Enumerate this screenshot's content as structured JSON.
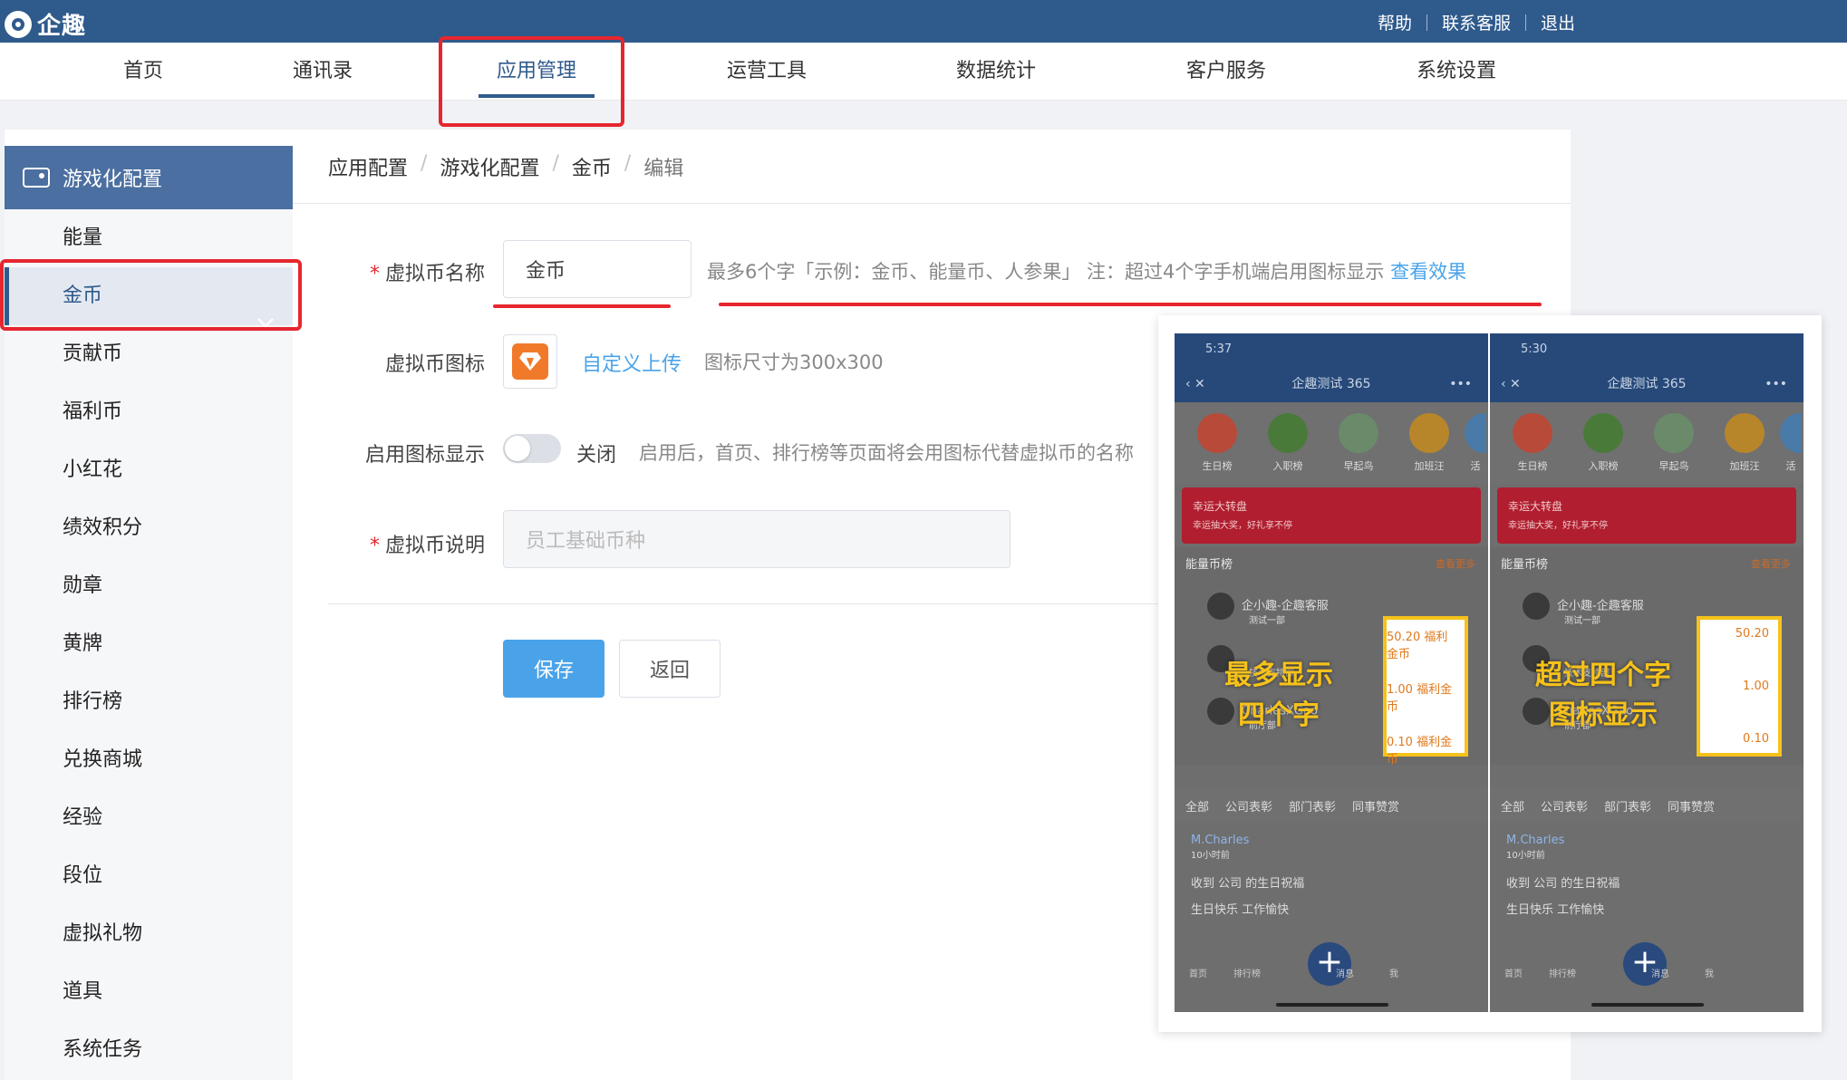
{
  "app": {
    "title": "企趣"
  },
  "toplinks": [
    "帮助",
    "联系客服",
    "退出"
  ],
  "nav": [
    "首页",
    "通讯录",
    "应用管理",
    "运营工具",
    "数据统计",
    "客户服务",
    "系统设置"
  ],
  "sidebar": {
    "header": "游戏化配置",
    "items": [
      "能量",
      "金币",
      "贡献币",
      "福利币",
      "小红花",
      "绩效积分",
      "勋章",
      "黄牌",
      "排行榜",
      "兑换商城",
      "经验",
      "段位",
      "虚拟礼物",
      "道具",
      "系统任务"
    ]
  },
  "breadcrumb": [
    "应用配置",
    "游戏化配置",
    "金币",
    "编辑"
  ],
  "form": {
    "name_label": "虚拟币名称",
    "name_value": "金币",
    "name_hint": "最多6个字「示例：金币、能量币、人参果」  注：超过4个字手机端启用图标显示",
    "name_link": "查看效果",
    "icon_label": "虚拟币图标",
    "icon_upload": "自定义上传",
    "icon_hint": "图标尺寸为300x300",
    "toggle_label": "启用图标显示",
    "toggle_state": "关闭",
    "toggle_hint": "启用后，首页、排行榜等页面将会用图标代替虚拟币的名称",
    "desc_label": "虚拟币说明",
    "desc_placeholder": "员工基础币种",
    "save": "保存",
    "back": "返回"
  },
  "preview": {
    "phones": [
      {
        "time": "5:37",
        "title": "企趣测试 365",
        "icons": [
          "生日榜",
          "入职榜",
          "早起鸟",
          "加班汪",
          "活"
        ],
        "banner_title": "幸运大转盘",
        "banner_sub": "幸运抽大奖，好礼享不停",
        "rank_title": "能量币榜",
        "rank_more": "查看更多",
        "rows": [
          {
            "name": "企小趣-企趣客服",
            "dept": "测试一部"
          },
          {
            "name": "",
            "dept": "技术支持部"
          },
          {
            "name": "CharlesXGao",
            "dept": "前厅部"
          }
        ],
        "values": [
          "50.20 福利金币",
          "1.00 福利金币",
          "0.10 福利金币"
        ],
        "overlay": [
          "最多显示",
          "四个字"
        ],
        "tabs": [
          "全部",
          "公司表彰",
          "部门表彰",
          "同事赞赏"
        ],
        "feed_user": "M.Charles",
        "feed_time": "10小时前",
        "feed_line1": "收到 公司 的生日祝福",
        "feed_line2": "生日快乐 工作愉快",
        "bottom_tabs": [
          "首页",
          "排行榜",
          "消息",
          "我"
        ]
      },
      {
        "time": "5:30",
        "title": "企趣测试 365",
        "icons": [
          "生日榜",
          "入职榜",
          "早起鸟",
          "加班汪",
          "活"
        ],
        "banner_title": "幸运大转盘",
        "banner_sub": "幸运抽大奖，好礼享不停",
        "rank_title": "能量币榜",
        "rank_more": "查看更多",
        "rows": [
          {
            "name": "企小趣-企趣客服",
            "dept": "测试一部"
          },
          {
            "name": "",
            "dept": "技术支持部"
          },
          {
            "name": "CharlesXGao",
            "dept": "前厅部"
          }
        ],
        "values": [
          "50.20",
          "1.00",
          "0.10"
        ],
        "overlay": [
          "超过四个字",
          "图标显示"
        ],
        "tabs": [
          "全部",
          "公司表彰",
          "部门表彰",
          "同事赞赏"
        ],
        "feed_user": "M.Charles",
        "feed_time": "10小时前",
        "feed_line1": "收到 公司 的生日祝福",
        "feed_line2": "生日快乐 工作愉快",
        "bottom_tabs": [
          "首页",
          "排行榜",
          "消息",
          "我"
        ]
      }
    ]
  },
  "colors": {
    "brand": "#2f5a8c",
    "accent": "#4aa3e9",
    "highlight": "#e6262e",
    "callout": "#f6c21a"
  }
}
